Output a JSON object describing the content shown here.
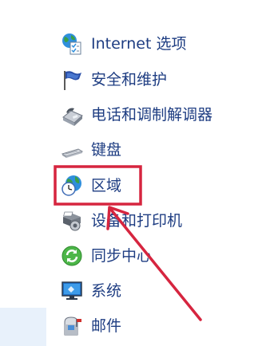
{
  "control_panel": {
    "items": [
      {
        "label": "Internet 选项",
        "icon": "internet-options-icon"
      },
      {
        "label": "安全和维护",
        "icon": "security-maintenance-flag-icon"
      },
      {
        "label": "电话和调制解调器",
        "icon": "phone-modem-icon"
      },
      {
        "label": "键盘",
        "icon": "keyboard-icon"
      },
      {
        "label": "区域",
        "icon": "region-globe-clock-icon"
      },
      {
        "label": "设备和打印机",
        "icon": "devices-printers-icon"
      },
      {
        "label": "同步中心",
        "icon": "sync-center-icon"
      },
      {
        "label": "系统",
        "icon": "system-monitor-icon"
      },
      {
        "label": "邮件",
        "icon": "mail-icon"
      }
    ]
  },
  "annotation": {
    "highlighted_item": "区域",
    "color": "#d6253f"
  },
  "colors": {
    "link_text": "#1e3d82",
    "selection_strip": "#e8f1fb"
  }
}
